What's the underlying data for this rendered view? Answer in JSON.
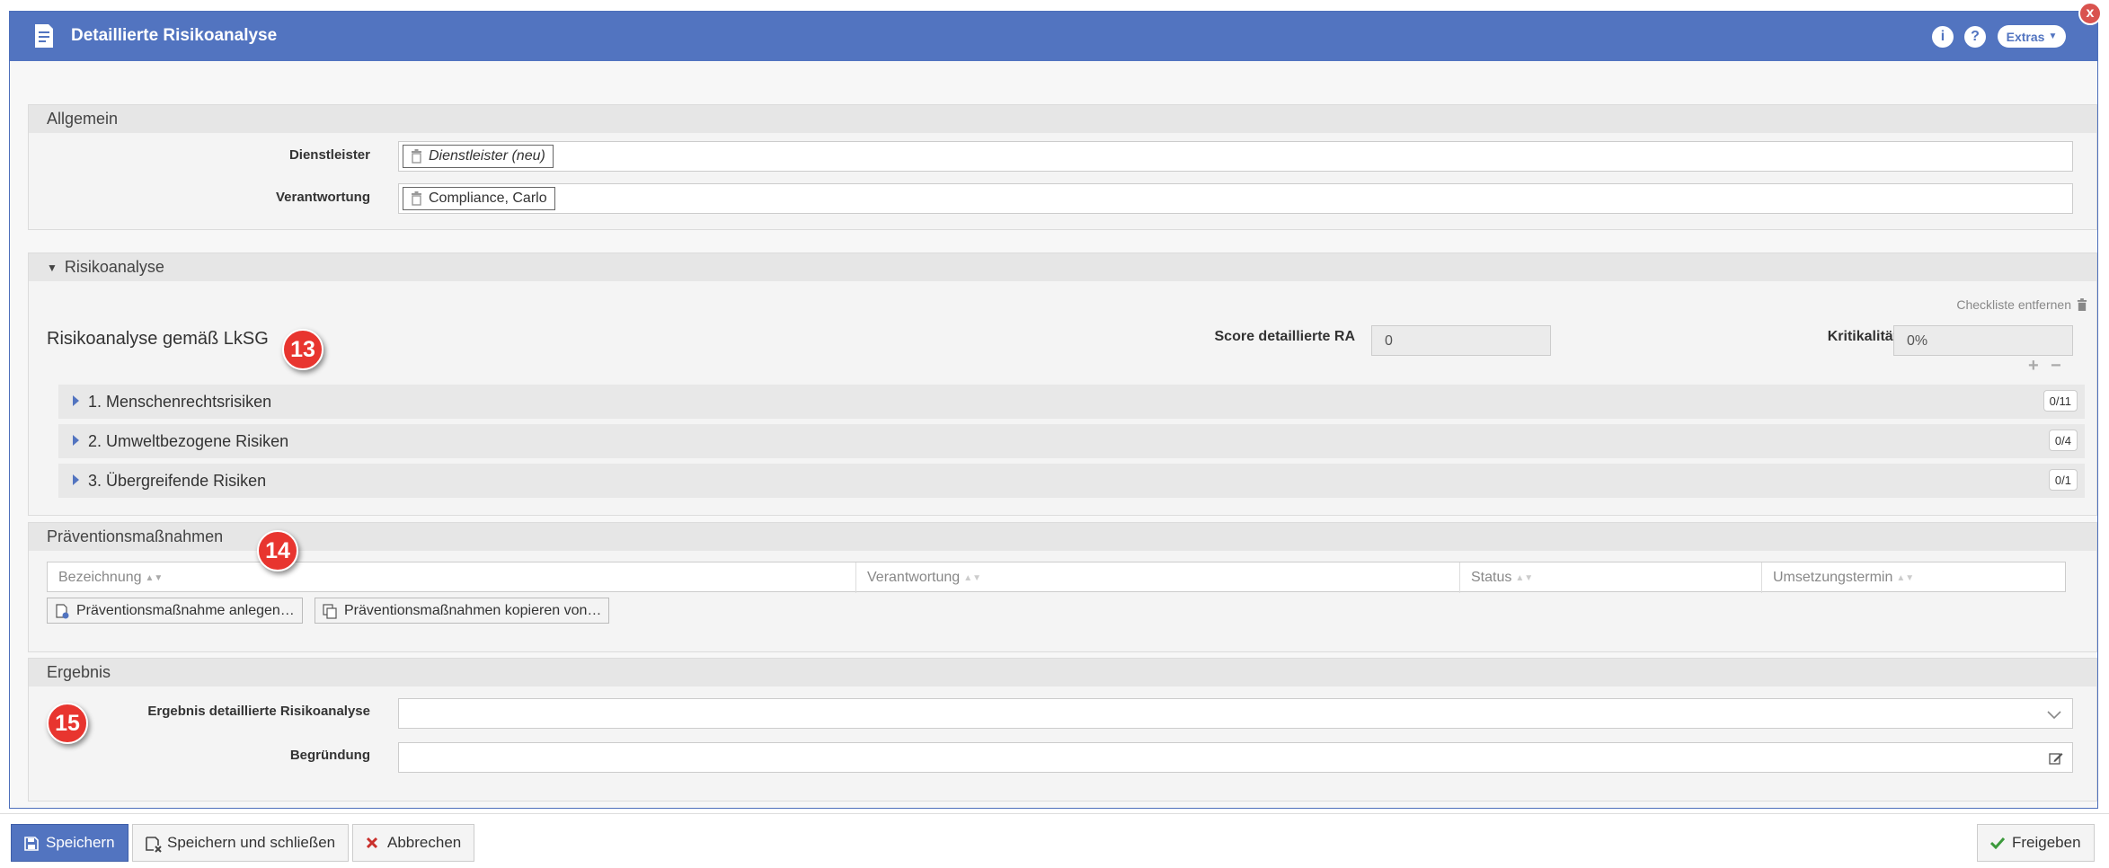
{
  "window": {
    "title": "Detaillierte Risikoanalyse",
    "info_icon": "i",
    "help_icon": "?",
    "extras_label": "Extras",
    "close_icon": "x",
    "accent_color": "#5274c0"
  },
  "allgemein": {
    "heading": "Allgemein",
    "dienstleister_label": "Dienstleister",
    "dienstleister_value": "Dienstleister (neu)",
    "verantwortung_label": "Verantwortung",
    "verantwortung_value": "Compliance, Carlo"
  },
  "risikoanalyse": {
    "heading": "Risikoanalyse",
    "checklist_title": "Risikoanalyse gemäß LkSG",
    "remove_checklist": "Checkliste entfernen",
    "score_label": "Score detaillierte RA",
    "score_value": "0",
    "kritikalitaet_label": "Kritikalität",
    "kritikalitaet_value": "0%",
    "expand_label": "+",
    "collapse_label": "−",
    "rows": [
      {
        "label": "1. Menschenrechtsrisiken",
        "count": "0/11"
      },
      {
        "label": "2. Umweltbezogene Risiken",
        "count": "0/4"
      },
      {
        "label": "3. Übergreifende Risiken",
        "count": "0/1"
      }
    ]
  },
  "praevention": {
    "heading": "Präventionsmaßnahmen",
    "columns": [
      "Bezeichnung",
      "Verantwortung",
      "Status",
      "Umsetzungstermin"
    ],
    "add_button": "Präventionsmaßnahme anlegen…",
    "copy_button": "Präventionsmaßnahmen kopieren von…"
  },
  "ergebnis": {
    "heading": "Ergebnis",
    "result_label": "Ergebnis detaillierte Risikoanalyse",
    "result_value": "",
    "begruendung_label": "Begründung",
    "begruendung_value": ""
  },
  "markers": [
    "13",
    "14",
    "15"
  ],
  "footer": {
    "save": "Speichern",
    "save_close": "Speichern und schließen",
    "cancel": "Abbrechen",
    "release": "Freigeben"
  }
}
